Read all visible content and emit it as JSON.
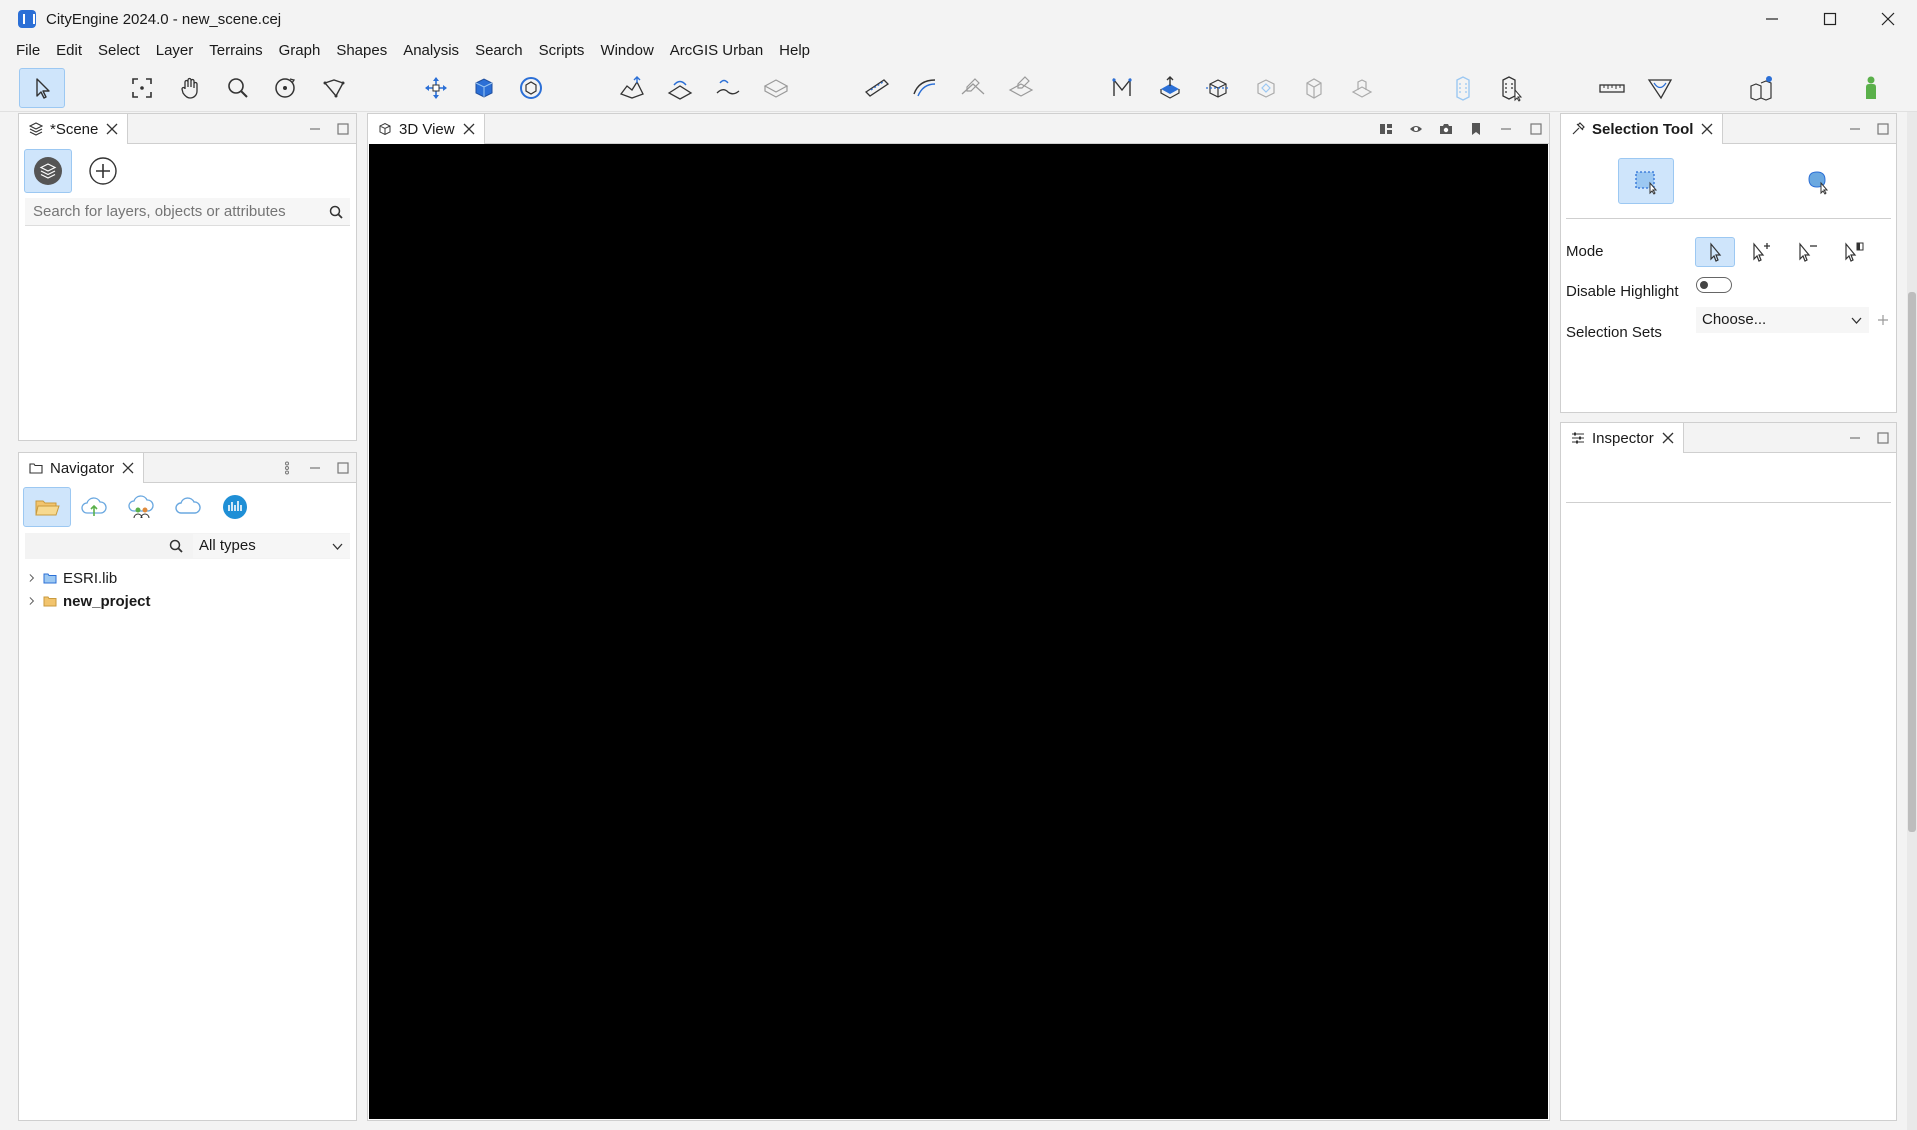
{
  "window": {
    "title": "CityEngine 2024.0 - new_scene.cej"
  },
  "menu": [
    "File",
    "Edit",
    "Select",
    "Layer",
    "Terrains",
    "Graph",
    "Shapes",
    "Analysis",
    "Search",
    "Scripts",
    "Window",
    "ArcGIS Urban",
    "Help"
  ],
  "toolbar": {
    "active_tool": "select-tool",
    "icons": [
      "select-tool-icon",
      "frame-icon",
      "pan-hand-icon",
      "zoom-icon",
      "orbit-icon",
      "lasso-icon",
      "move-icon",
      "scale-icon",
      "rotate-icon",
      "terrain-raise-icon",
      "terrain-smooth-icon",
      "terrain-flatten-icon",
      "terrain-align-icon",
      "street-create-icon",
      "curve-street-icon",
      "street-edit-icon",
      "street-merge-icon",
      "polygon-shape-icon",
      "extrude-icon",
      "subdivide-icon",
      "split-icon",
      "offset-icon",
      "model-icon",
      "building-icon",
      "building-select-icon",
      "measure-icon",
      "section-icon",
      "city-icon",
      "person-icon"
    ]
  },
  "scene_panel": {
    "tab": "*Scene",
    "search_placeholder": "Search for layers, objects or attributes"
  },
  "navigator_panel": {
    "tab": "Navigator",
    "filter": "All types",
    "tree": [
      {
        "label": "ESRI.lib",
        "bold": false
      },
      {
        "label": "new_project",
        "bold": true
      }
    ]
  },
  "view_panel": {
    "tab": "3D View"
  },
  "selection_panel": {
    "tab": "Selection Tool",
    "mode_label": "Mode",
    "disable_highlight_label": "Disable Highlight",
    "selection_sets_label": "Selection Sets",
    "selection_sets_value": "Choose..."
  },
  "inspector_panel": {
    "tab": "Inspector"
  },
  "colors": {
    "accent": "#2b6fd6",
    "active_bg": "#cfe5fb",
    "viewport": "#000000"
  }
}
